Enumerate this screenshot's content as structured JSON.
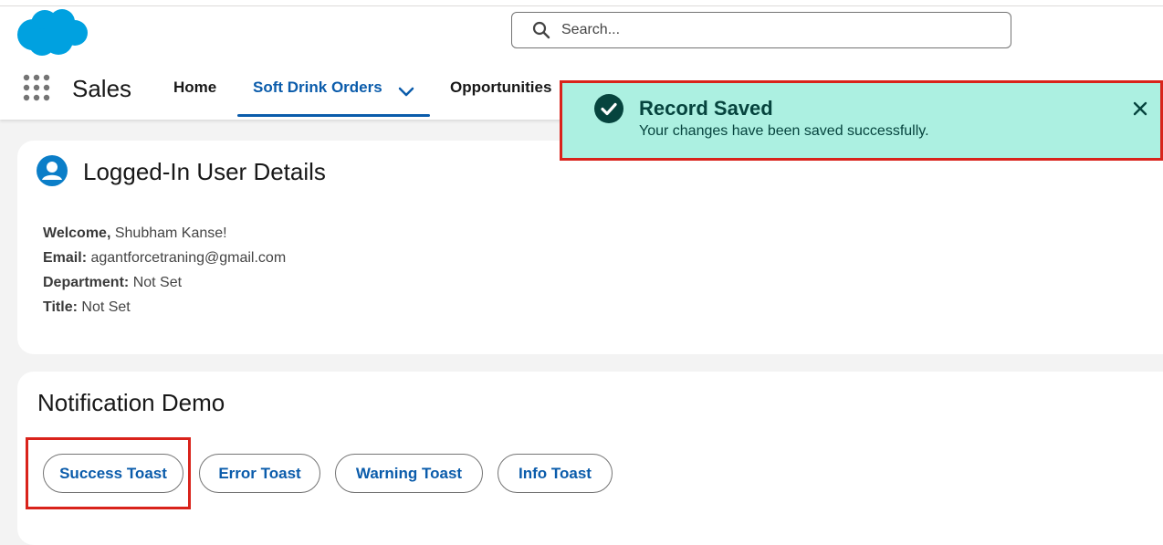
{
  "header": {
    "app_name": "Sales",
    "search_placeholder": "Search..."
  },
  "nav": {
    "home": "Home",
    "soft_drink_orders": "Soft Drink Orders",
    "opportunities": "Opportunities"
  },
  "icons": {
    "logo": "salesforce-cloud-icon",
    "search": "search-icon",
    "launcher": "app-launcher-icon",
    "chevron": "chevron-down-icon",
    "user": "user-icon",
    "success": "check-circle-icon",
    "close": "close-icon"
  },
  "user_card": {
    "title": "Logged-In User Details",
    "welcome_label": "Welcome,",
    "welcome_value": "Shubham Kanse!",
    "email_label": "Email:",
    "email_value": "agantforcetraning@gmail.com",
    "department_label": "Department:",
    "department_value": "Not Set",
    "title_label": "Title:",
    "title_value": "Not Set"
  },
  "notification_card": {
    "title": "Notification Demo",
    "buttons": [
      "Success Toast",
      "Error Toast",
      "Warning Toast",
      "Info Toast"
    ]
  },
  "toast": {
    "title": "Record Saved",
    "message": "Your changes have been saved successfully."
  },
  "colors": {
    "brand_blue": "#0b5cab",
    "logo_blue": "#00a1e0",
    "toast_bg": "#acf0e1",
    "toast_text": "#06443e",
    "highlight_red": "#d9231b"
  }
}
